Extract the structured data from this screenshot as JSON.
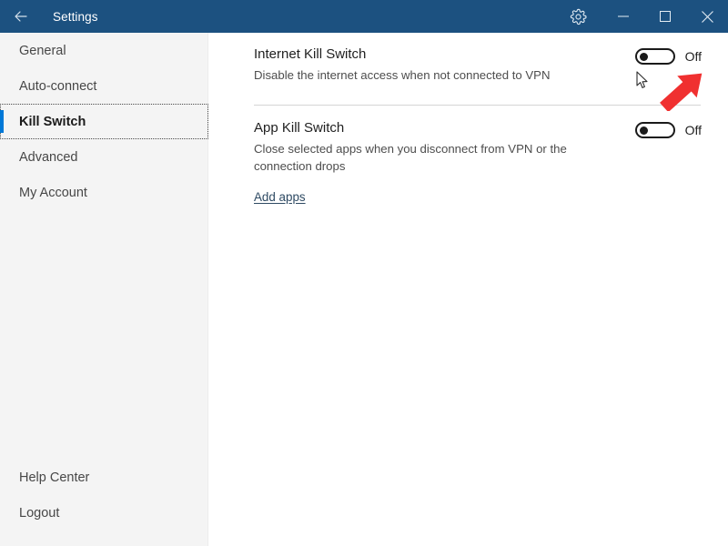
{
  "window": {
    "title": "Settings",
    "back_icon": "back-arrow-icon",
    "gear_icon": "gear-icon",
    "minimize_icon": "minimize-icon",
    "maximize_icon": "maximize-icon",
    "close_icon": "close-icon",
    "titlebar_color": "#1c5180"
  },
  "sidebar": {
    "background": "#f4f4f4",
    "accent_color": "#0078d7",
    "items": [
      {
        "label": "General",
        "selected": false
      },
      {
        "label": "Auto-connect",
        "selected": false
      },
      {
        "label": "Kill Switch",
        "selected": true
      },
      {
        "label": "Advanced",
        "selected": false
      },
      {
        "label": "My Account",
        "selected": false
      }
    ],
    "bottom_items": [
      {
        "label": "Help Center"
      },
      {
        "label": "Logout"
      }
    ]
  },
  "main": {
    "sections": [
      {
        "title": "Internet Kill Switch",
        "description": "Disable the internet access when not connected to VPN",
        "toggle_state": "off",
        "toggle_label": "Off"
      },
      {
        "title": "App Kill Switch",
        "description": "Close selected apps when you disconnect from VPN or the connection drops",
        "toggle_state": "off",
        "toggle_label": "Off",
        "link_label": "Add apps"
      }
    ]
  },
  "annotations": {
    "cursor_icon": "mouse-pointer-icon",
    "pointer_icon": "red-arrow-annotation-icon",
    "pointer_color": "#f03030"
  }
}
